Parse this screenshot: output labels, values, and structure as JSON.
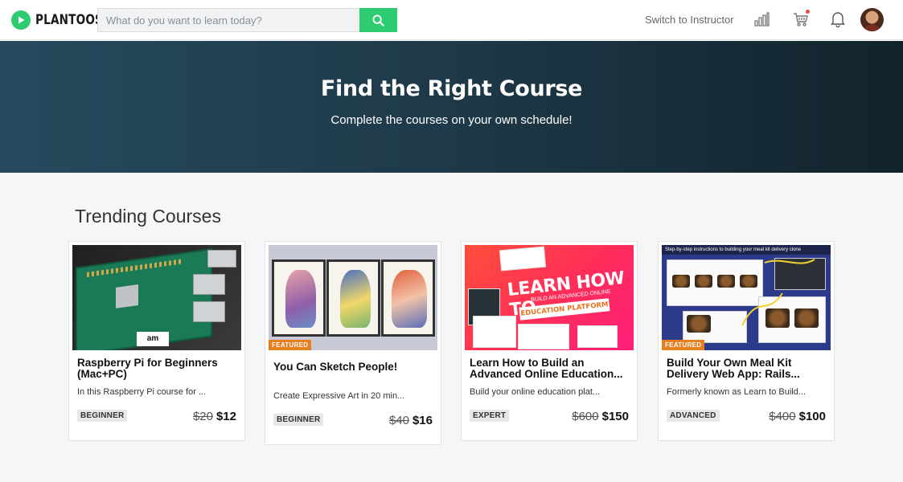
{
  "header": {
    "brand": "PLANTOOST",
    "search_placeholder": "What do you want to learn today?",
    "switch_link": "Switch to Instructor",
    "icons": [
      "logo-play-icon",
      "search-icon",
      "bar-chart-icon",
      "cart-icon",
      "bell-icon",
      "avatar"
    ],
    "accent_color": "#2ecc71"
  },
  "hero": {
    "title": "Find the Right Course",
    "subtitle": "Complete the courses on your own schedule!"
  },
  "section": {
    "title": "Trending Courses"
  },
  "courses": [
    {
      "title": "Raspberry Pi for Beginners (Mac+PC)",
      "description": "In this Raspberry Pi course for ...",
      "level": "BEGINNER",
      "old_price": "$20",
      "price": "$12",
      "featured": false
    },
    {
      "title": "You Can Sketch People!",
      "description": "Create Expressive Art in 20 min...",
      "level": "BEGINNER",
      "old_price": "$40",
      "price": "$16",
      "featured": true,
      "featured_label": "FEATURED"
    },
    {
      "title": "Learn How to Build an Advanced Online Education...",
      "description": "Build your online education plat...",
      "level": "EXPERT",
      "old_price": "$600",
      "price": "$150",
      "featured": false,
      "thumb_text": {
        "big": "LEARN HOW TO",
        "small": "BUILD AN ADVANCED ONLINE",
        "strip": "EDUCATION PLATFORM"
      }
    },
    {
      "title": "Build Your Own Meal Kit Delivery Web App: Rails...",
      "description": "Formerly known as Learn to Build...",
      "level": "ADVANCED",
      "old_price": "$400",
      "price": "$100",
      "featured": true,
      "featured_label": "FEATURED",
      "thumb_text": {
        "banner": "Step-by-step instructions to building your meal kit delivery clone"
      }
    }
  ]
}
